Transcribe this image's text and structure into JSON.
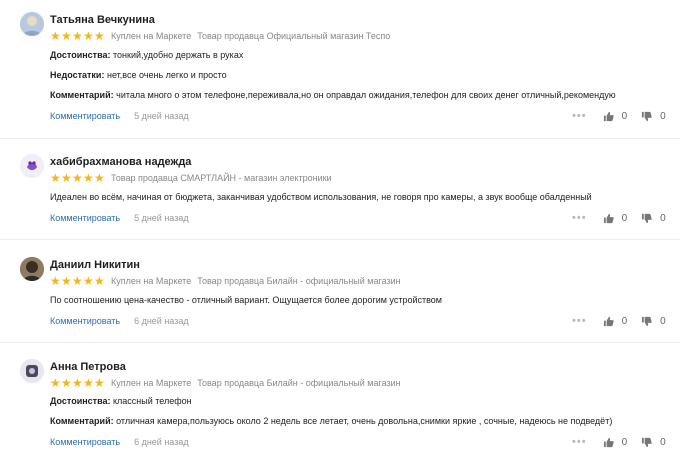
{
  "ui": {
    "comment_label": "Комментировать",
    "star": "★"
  },
  "reviews": [
    {
      "name": "Татьяна Вечкунина",
      "rating": 5,
      "bought": "Куплен на Маркете",
      "seller": "Товар продавца Официальный магазин Теспо",
      "pros_label": "Достоинства:",
      "pros": "тонкий,удобно держать в руках",
      "cons_label": "Недостатки:",
      "cons": "нет,все очень легко и просто",
      "comment_label": "Комментарий:",
      "comment": "читала много о этом телефоне,переживала,но он оправдал ожидания,телефон для своих денег отличный,рекомендую",
      "date": "5 дней назад",
      "likes": "0",
      "dislikes": "0"
    },
    {
      "name": "хабибрахманова надежда",
      "rating": 5,
      "seller": "Товар продавца СМАРТЛАЙН - магазин электроники",
      "text": "Идеален во всём, начиная от бюджета, заканчивая удобством использования, не говоря про камеры, а звук вообще обалденный",
      "date": "5 дней назад",
      "likes": "0",
      "dislikes": "0"
    },
    {
      "name": "Даниил Никитин",
      "rating": 5,
      "bought": "Куплен на Маркете",
      "seller": "Товар продавца Билайн - официальный магазин",
      "text": "По соотношению цена-качество - отличный вариант. Ощущается более дорогим устройством",
      "date": "6 дней назад",
      "likes": "0",
      "dislikes": "0"
    },
    {
      "name": "Анна Петрова",
      "rating": 5,
      "bought": "Куплен на Маркете",
      "seller": "Товар продавца Билайн - официальный магазин",
      "pros_label": "Достоинства:",
      "pros": "классный телефон",
      "comment_label": "Комментарий:",
      "comment": "отличная камера,пользуюсь около 2 недель все летает, очень довольна,снимки яркие , сочные, надеюсь не подведёт)",
      "date": "6 дней назад",
      "likes": "0",
      "dislikes": "0"
    }
  ]
}
